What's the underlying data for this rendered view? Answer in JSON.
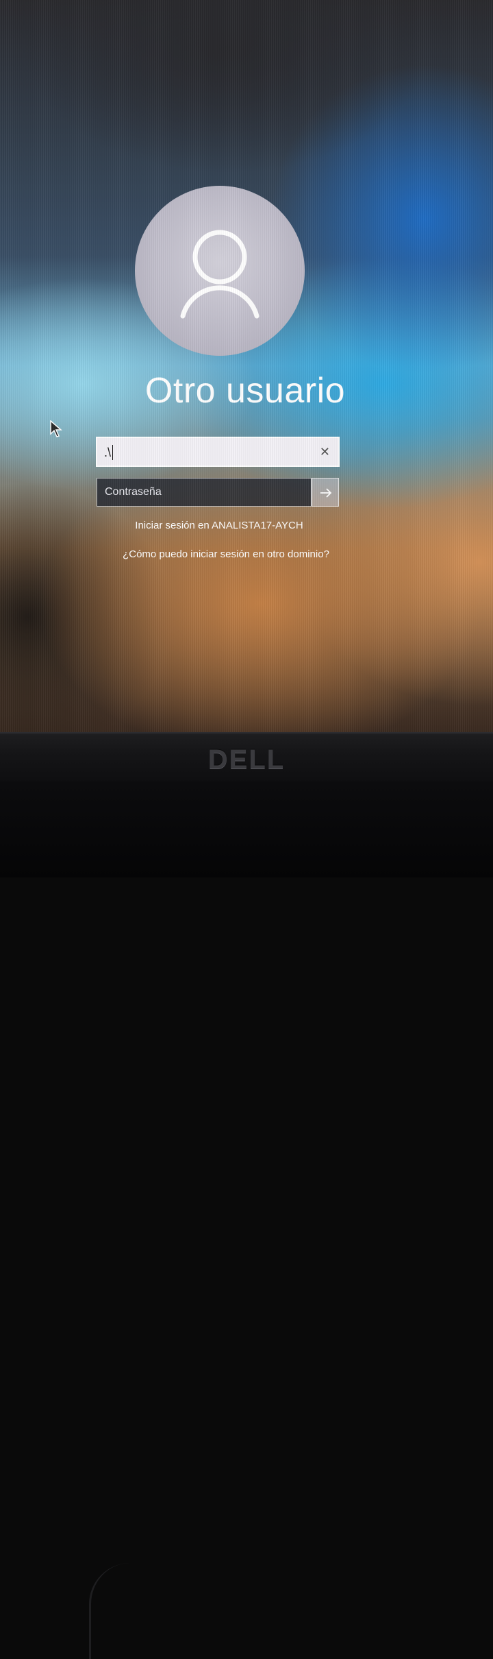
{
  "login": {
    "user_name": "Otro usuario",
    "username_value": ".\\",
    "password_placeholder": "Contraseña",
    "sign_in_to": "Iniciar sesión en ANALISTA17-AYCH",
    "other_domain_link": "¿Cómo puedo iniciar sesión en otro dominio?"
  },
  "icons": {
    "avatar": "user-silhouette-icon",
    "clear": "close-icon",
    "submit": "arrow-right-icon",
    "cursor": "mouse-pointer-icon"
  },
  "monitor": {
    "brand": "DELL"
  },
  "colors": {
    "field_bg": "#f3f1f6",
    "text": "#ffffff"
  }
}
